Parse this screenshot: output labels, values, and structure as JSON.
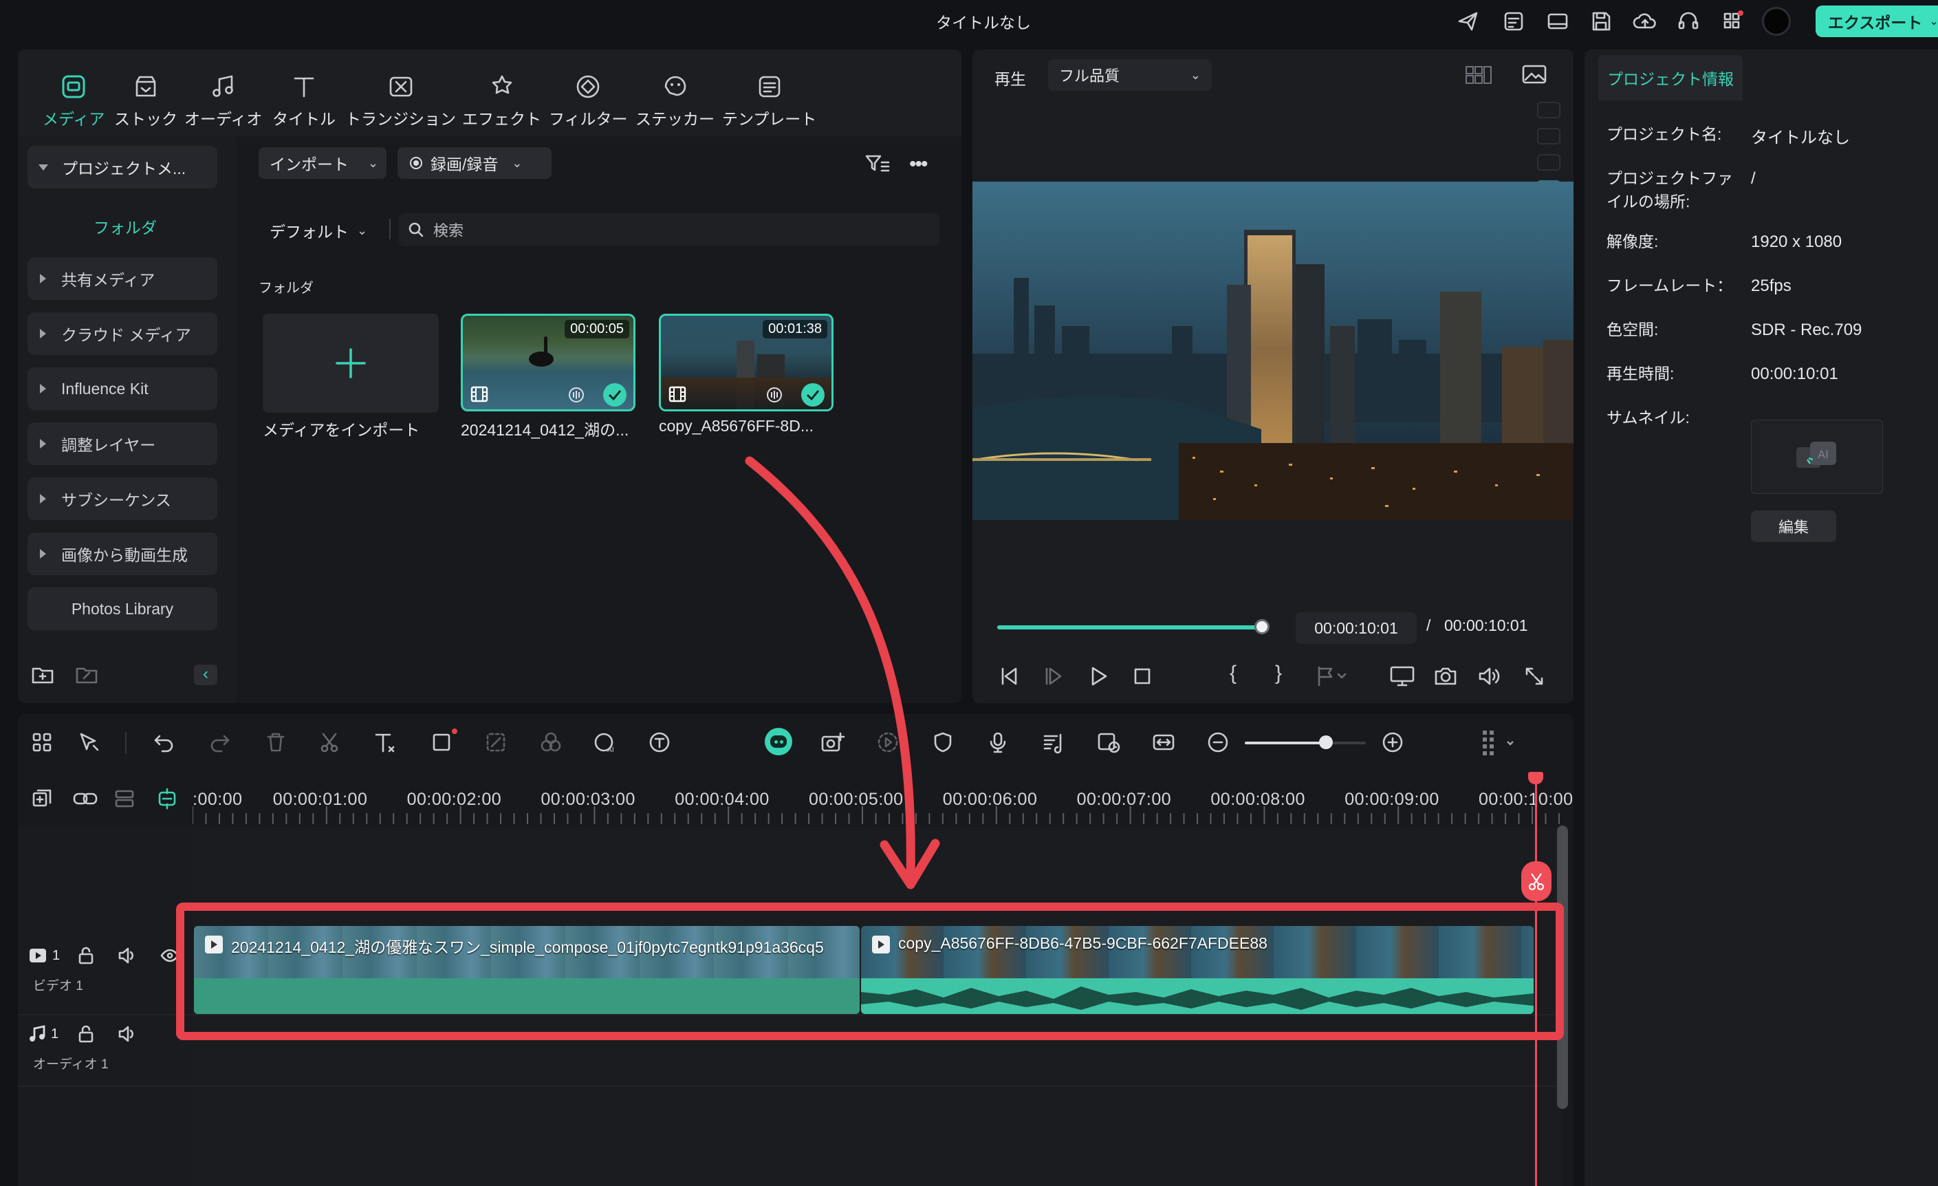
{
  "window": {
    "title": "タイトルなし",
    "export_label": "エクスポート"
  },
  "media_toolbar": {
    "tabs": [
      {
        "label": "メディア",
        "icon": "media-icon"
      },
      {
        "label": "ストック",
        "icon": "stock-icon"
      },
      {
        "label": "オーディオ",
        "icon": "music-note-icon"
      },
      {
        "label": "タイトル",
        "icon": "title-t-icon"
      },
      {
        "label": "トランジション",
        "icon": "transition-icon"
      },
      {
        "label": "エフェクト",
        "icon": "effect-icon"
      },
      {
        "label": "フィルター",
        "icon": "filter-icon"
      },
      {
        "label": "ステッカー",
        "icon": "sticker-icon"
      },
      {
        "label": "テンプレート",
        "icon": "template-icon"
      }
    ]
  },
  "sidebar": {
    "project_media": "プロジェクトメ...",
    "folder": "フォルダ",
    "items": [
      "共有メディア",
      "クラウド メディア",
      "Influence Kit",
      "調整レイヤー",
      "サブシーケンス",
      "画像から動画生成"
    ],
    "photos_library": "Photos Library"
  },
  "media_panel": {
    "import_button": "インポート",
    "record_button": "録画/録音",
    "sort_default": "デフォルト",
    "search_placeholder": "検索",
    "folder_heading": "フォルダ",
    "import_tile_label": "メディアをインポート",
    "clips": [
      {
        "duration": "00:00:05",
        "name": "20241214_0412_湖の..."
      },
      {
        "duration": "00:01:38",
        "name": "copy_A85676FF-8D..."
      }
    ]
  },
  "preview": {
    "play_label": "再生",
    "quality": "フル品質",
    "current_time": "00:00:10:01",
    "separator": "/",
    "total_time": "00:00:10:01",
    "progress": 1.0
  },
  "project_info": {
    "tab": "プロジェクト情報",
    "rows": [
      {
        "label": "プロジェクト名:",
        "value": "タイトルなし"
      },
      {
        "label": "プロジェクトファ\nイルの場所:",
        "value": "/"
      },
      {
        "label": "解像度:",
        "value": "1920 x 1080"
      },
      {
        "label": "フレームレート：",
        "value": "25fps"
      },
      {
        "label": "色空間:",
        "value": "SDR - Rec.709"
      },
      {
        "label": "再生時間:",
        "value": "00:00:10:01"
      },
      {
        "label": "サムネイル:",
        "value": ""
      }
    ],
    "edit_button": "編集"
  },
  "timeline": {
    "ruler": [
      ":00:00",
      "00:00:01:00",
      "00:00:02:00",
      "00:00:03:00",
      "00:00:04:00",
      "00:00:05:00",
      "00:00:06:00",
      "00:00:07:00",
      "00:00:08:00",
      "00:00:09:00",
      "00:00:10:00"
    ],
    "zoom_level": 0.67,
    "tracks": {
      "video": {
        "index": "1",
        "name": "ビデオ 1"
      },
      "audio": {
        "index": "1",
        "name": "オーディオ 1"
      }
    },
    "clips": [
      {
        "name": "20241214_0412_湖の優雅なスワン_simple_compose_01jf0pytc7egntk91p91a36cq5"
      },
      {
        "name": "copy_A85676FF-8DB6-47B5-9CBF-662F7AFDEE88"
      }
    ]
  },
  "colors": {
    "accent": "#39d3b4",
    "annotation": "#e8424c",
    "playhead": "#ef4d57"
  }
}
